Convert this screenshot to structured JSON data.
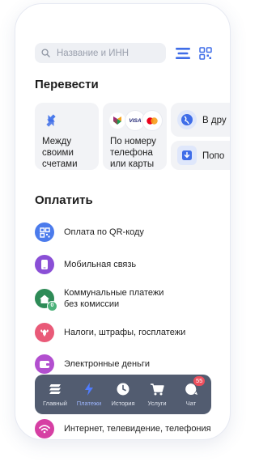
{
  "search": {
    "placeholder": "Название и ИНН"
  },
  "transfer": {
    "title": "Перевести",
    "cards": [
      {
        "label_lines": [
          "Между",
          "своими",
          "счетами"
        ]
      },
      {
        "label_lines": [
          "По номеру",
          "телефона",
          "или карты"
        ],
        "brands": [
          "VISA"
        ]
      },
      {
        "label": "В дру"
      },
      {
        "label": "Попо"
      }
    ]
  },
  "pay": {
    "title": "Оплатить",
    "items": [
      {
        "label": "Оплата по QR-коду",
        "icon": "qr-icon",
        "color": "#4b7bec"
      },
      {
        "label": "Мобильная связь",
        "icon": "phone-icon",
        "color": "#8a4fd6"
      },
      {
        "label_lines": [
          "Коммунальные платежи",
          "без комиссии"
        ],
        "icon": "house-icon",
        "color": "#2e8b57",
        "badge": "0"
      },
      {
        "label": "Налоги, штрафы, госплатежи",
        "icon": "emblem-icon",
        "color": "#e95a78"
      },
      {
        "label": "Электронные деньги",
        "icon": "wallet-icon",
        "color": "#b24fcf"
      },
      {
        "label": "Интернет, телевидение, телефония",
        "icon": "wifi-icon",
        "color": "#d63fa3"
      }
    ]
  },
  "tabbar": {
    "tabs": [
      {
        "label": "Главный",
        "icon": "home-stack-icon"
      },
      {
        "label": "Платежи",
        "icon": "lightning-icon",
        "active": true
      },
      {
        "label": "История",
        "icon": "clock-icon"
      },
      {
        "label": "Услуги",
        "icon": "cart-icon"
      },
      {
        "label": "Чат",
        "icon": "chat-icon",
        "badge": "55"
      }
    ]
  },
  "colors": {
    "accent": "#3f6de8",
    "card_bg": "#f2f3f6",
    "tabbar_bg": "#525c70",
    "badge": "#ec4f5d"
  }
}
